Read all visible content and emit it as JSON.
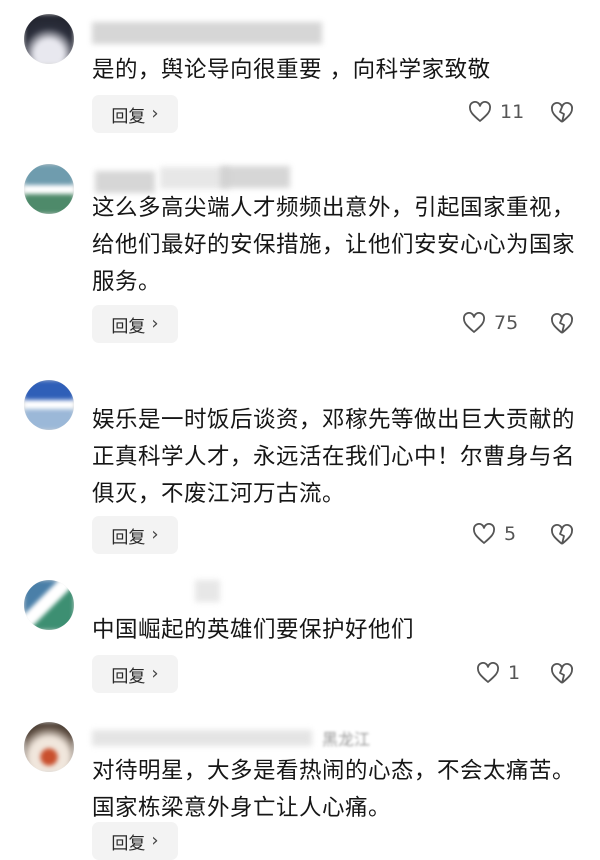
{
  "comments": [
    {
      "text": "是的，舆论导向很重要 ，向科学家致敬",
      "reply_label": "回复",
      "likes": "11"
    },
    {
      "text": "这么多高尖端人才频频出意外，引起国家重视，给他们最好的安保措施，让他们安安心心为国家服务。",
      "reply_label": "回复",
      "likes": "75"
    },
    {
      "text": "娱乐是一时饭后谈资，邓稼先等做出巨大贡献的正真科学人才，永远活在我们心中！尔曹身与名俱灭，不废江河万古流。",
      "reply_label": "回复",
      "likes": "5"
    },
    {
      "text": "中国崛起的英雄们要保护好他们",
      "reply_label": "回复",
      "likes": "1"
    },
    {
      "author_partial": "黑龙江",
      "text": "对待明星，大多是看热闹的心态，不会太痛苦。国家栋梁意外身亡让人心痛。",
      "reply_label": "回复"
    }
  ],
  "icons": {
    "like": "heart-outline-icon",
    "dislike": "broken-heart-icon",
    "reply_chevron": "chevron-right-icon"
  },
  "colors": {
    "text": "#161616",
    "button_bg": "#f3f3f3",
    "icon": "#555555"
  }
}
